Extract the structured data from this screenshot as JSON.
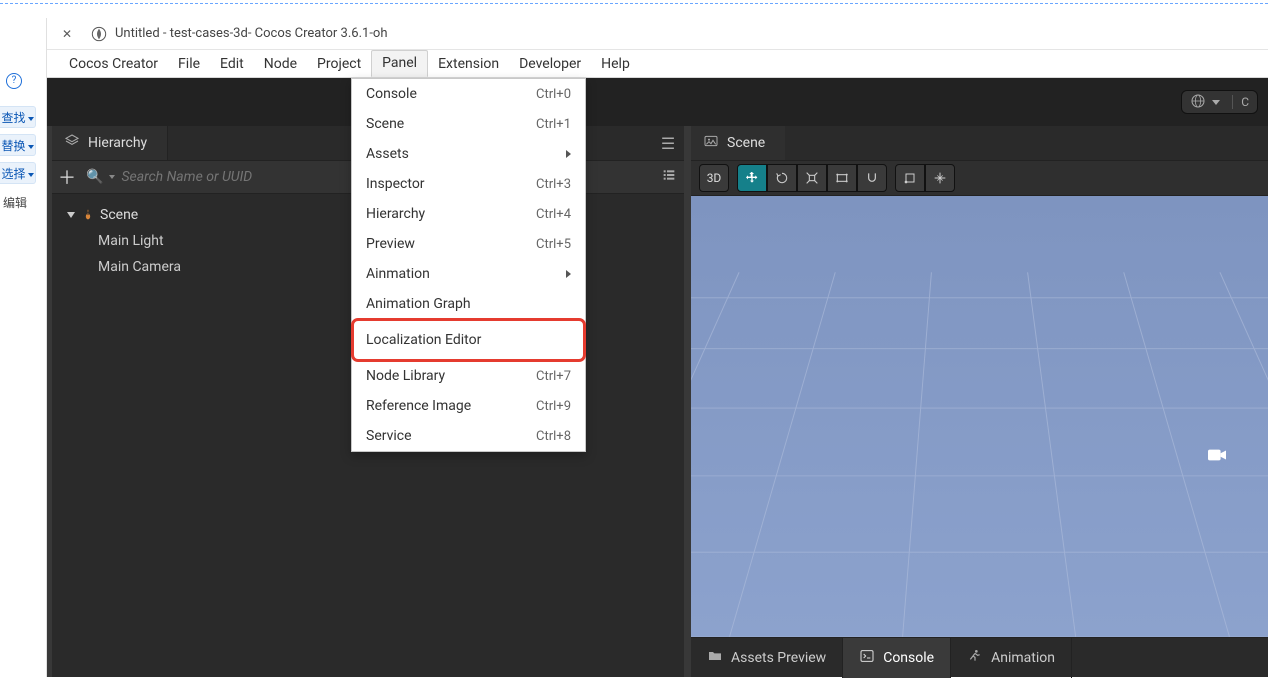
{
  "title": "Untitled - test-cases-3d- Cocos Creator 3.6.1-oh",
  "menubar": [
    "Cocos Creator",
    "File",
    "Edit",
    "Node",
    "Project",
    "Panel",
    "Extension",
    "Developer",
    "Help"
  ],
  "menubar_active_index": 5,
  "host_sidebar": {
    "find": "查找",
    "replace": "替换",
    "select": "选择",
    "edit": "编辑"
  },
  "dropdown": {
    "items": [
      {
        "label": "Console",
        "shortcut": "Ctrl+0"
      },
      {
        "label": "Scene",
        "shortcut": "Ctrl+1"
      },
      {
        "label": "Assets",
        "submenu": true
      },
      {
        "label": "Inspector",
        "shortcut": "Ctrl+3"
      },
      {
        "label": "Hierarchy",
        "shortcut": "Ctrl+4"
      },
      {
        "label": "Preview",
        "shortcut": "Ctrl+5"
      },
      {
        "label": "Ainmation",
        "submenu": true
      },
      {
        "label": "Animation Graph"
      },
      {
        "label": "Localization Editor",
        "highlight": true
      },
      {
        "label": "Node Library",
        "shortcut": "Ctrl+7"
      },
      {
        "label": "Reference Image",
        "shortcut": "Ctrl+9"
      },
      {
        "label": "Service",
        "shortcut": "Ctrl+8"
      }
    ]
  },
  "hierarchy": {
    "tab_label": "Hierarchy",
    "search_placeholder": "Search Name or UUID",
    "tree": {
      "root": "Scene",
      "children": [
        "Main Light",
        "Main Camera"
      ]
    }
  },
  "scene": {
    "tab_label": "Scene",
    "toolbar": {
      "view3d": "3D"
    }
  },
  "top_right": {
    "label": "C"
  },
  "bottom_tabs": [
    {
      "label": "Assets Preview",
      "icon": "folder-icon"
    },
    {
      "label": "Console",
      "icon": "terminal-icon",
      "active": true
    },
    {
      "label": "Animation",
      "icon": "run-icon"
    }
  ]
}
